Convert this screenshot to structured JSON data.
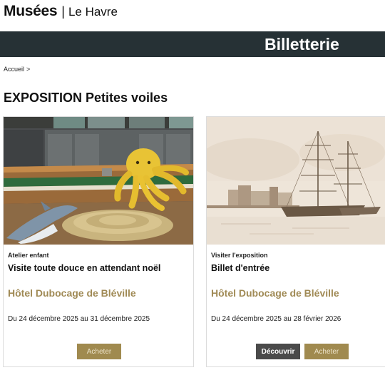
{
  "header": {
    "logo_main": "Musées",
    "logo_separator": "|",
    "logo_city": "Le Havre"
  },
  "banner": {
    "title": "Billetterie",
    "background": "#263135"
  },
  "breadcrumb": {
    "home": "Accueil",
    "separator": ">"
  },
  "page": {
    "title": "EXPOSITION Petites voiles"
  },
  "cards": [
    {
      "image": "photo-boat-octopus-shark-plush",
      "category": "Atelier enfant",
      "title": "Visite toute douce en attendant noël",
      "venue": "Hôtel Dubocage de Bléville",
      "dates": "Du 24 décembre 2025 au 31 décembre 2025",
      "buttons": {
        "buy": "Acheter"
      }
    },
    {
      "image": "sepia-drawing-sailing-ships-harbour",
      "category": "Visiter l'exposition",
      "title": "Billet d'entrée",
      "venue": "Hôtel Dubocage de Bléville",
      "dates": "Du 24 décembre 2025 au 28 février 2026",
      "buttons": {
        "discover": "Découvrir",
        "buy": "Acheter"
      }
    }
  ],
  "colors": {
    "accent_gold": "#a08a55",
    "button_gold": "#a08a4f",
    "button_dark": "#4a4a4a"
  }
}
